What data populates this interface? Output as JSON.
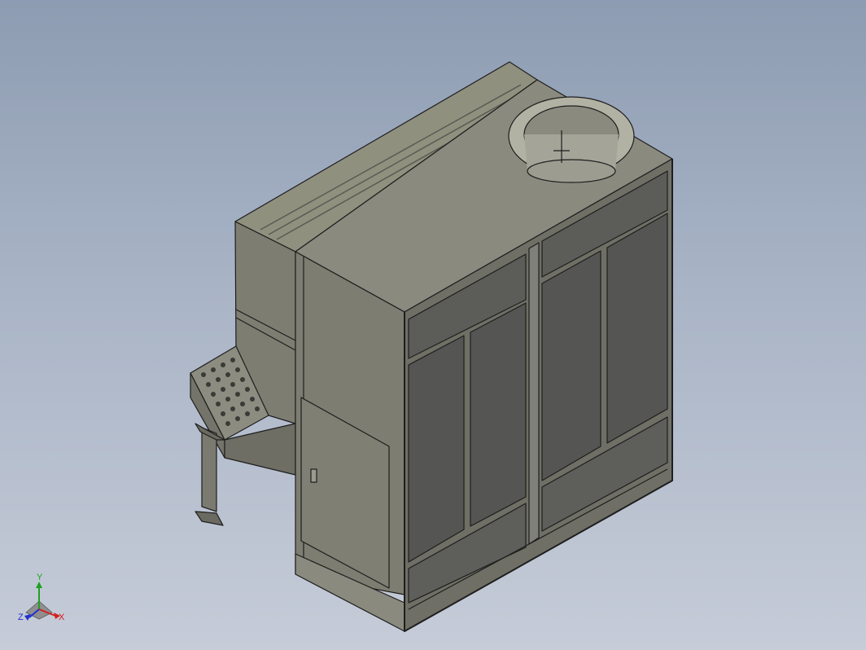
{
  "view": {
    "background_top": "#8d9cb2",
    "background_bottom": "#c6ccd8",
    "triad": {
      "x_label": "X",
      "y_label": "Y",
      "z_label": "Z",
      "x_color": "#d42020",
      "y_color": "#20a020",
      "z_color": "#2030d0"
    }
  },
  "model": {
    "body_color": "#8a8a7f",
    "panel_color": "#5a5a58",
    "edge_color": "#1e1e1e"
  }
}
